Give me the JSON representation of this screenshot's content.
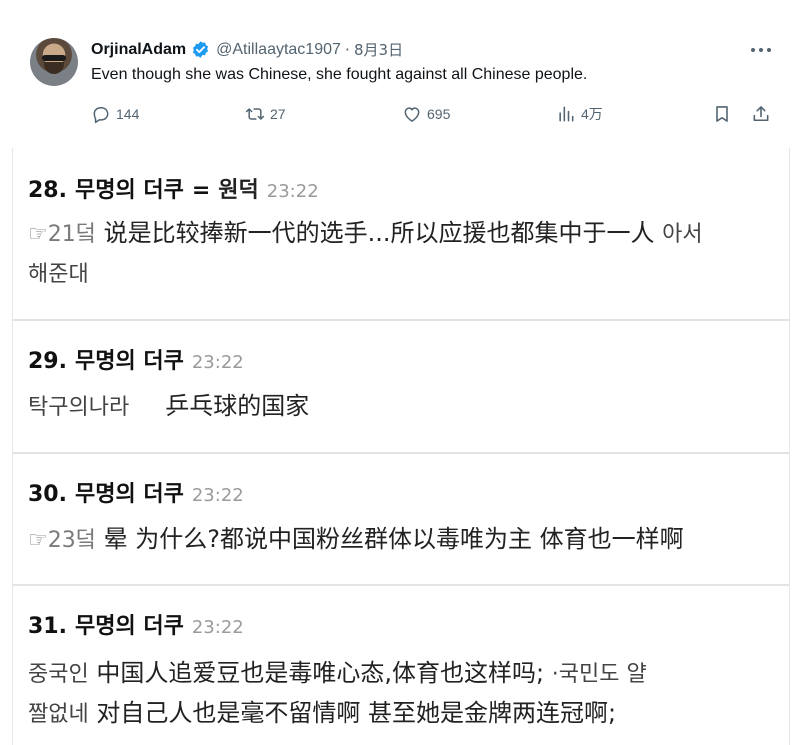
{
  "tweet": {
    "author": "OrjinalAdam",
    "handle": "@Atillaaytac1907",
    "separator": "·",
    "date": "8月3日",
    "text": "Even though she was Chinese, she fought against all Chinese people.",
    "replies": "144",
    "retweets": "27",
    "likes": "695",
    "views": "4万"
  },
  "colors": {
    "verified": "#1d9bf0",
    "muted": "#536471",
    "timestamp": "#9a9a9a"
  },
  "icons": [
    "verified-badge-icon",
    "more-options-icon",
    "reply-icon",
    "retweet-icon",
    "like-icon",
    "views-icon",
    "bookmark-icon",
    "share-icon"
  ],
  "posts": [
    {
      "num": "28.",
      "nick": "무명의 더쿠",
      "sep": "=",
      "nick2": "원덕",
      "time": "23:22",
      "lines": [
        {
          "ref": "☞21덬",
          "text": "说是比较捧新一代的选手...所以应援也都集中于一人",
          "ko_after": "아서"
        },
        {
          "text": "해준대"
        }
      ]
    },
    {
      "num": "29.",
      "nick": "무명의 더쿠",
      "time": "23:22",
      "lines": [
        {
          "ko": "탁구의나라",
          "text": "乒乓球的国家"
        }
      ]
    },
    {
      "num": "30.",
      "nick": "무명의 더쿠",
      "time": "23:22",
      "lines": [
        {
          "ref": "☞23덬",
          "text": "晕 为什么?都说中国粉丝群体以毒唯为主 体育也一样啊"
        }
      ]
    },
    {
      "num": "31.",
      "nick": "무명의 더쿠",
      "time": "23:22",
      "lines": [
        {
          "ko": "중국인",
          "text": "中国人追爱豆也是毒唯心态,体育也这样吗;",
          "ko_after": "·국민도 얄"
        },
        {
          "ko": "짤없네",
          "text": "对自己人也是毫不留情啊 甚至她是金牌两连冠啊;"
        }
      ]
    }
  ]
}
